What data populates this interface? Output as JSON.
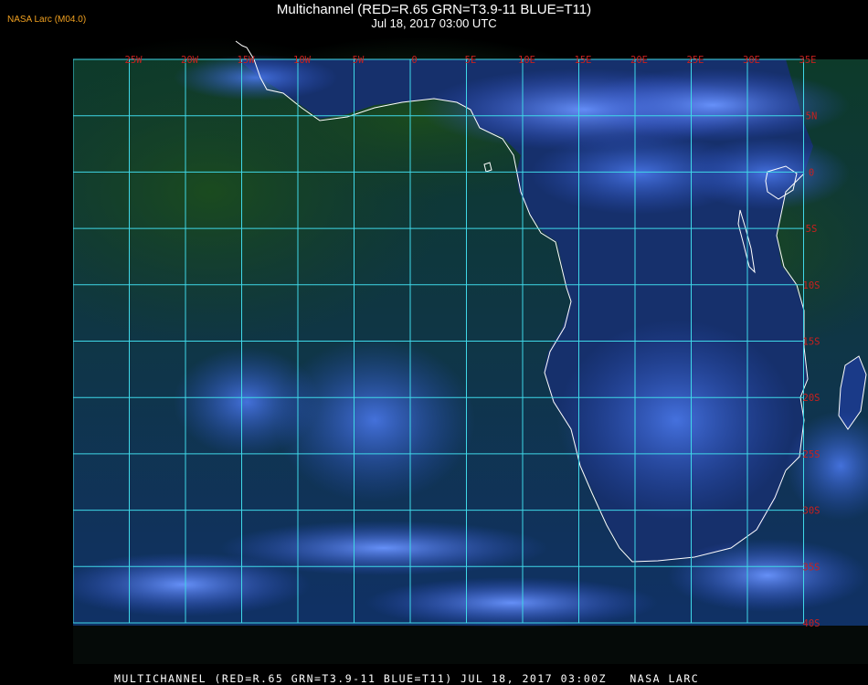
{
  "header": {
    "title": "Multichannel (RED=R.65 GRN=T3.9-11 BLUE=T11)",
    "datetime": "Jul 18, 2017 03:00 UTC",
    "badge": "NASA Larc (M04.0)"
  },
  "footer": {
    "caption": "MULTICHANNEL (RED=R.65 GRN=T3.9-11 BLUE=T11) JUL 18, 2017 03:00Z   NASA LARC"
  },
  "map": {
    "longitude_labels": [
      "25W",
      "20W",
      "15W",
      "10W",
      "5W",
      "0",
      "5E",
      "10E",
      "15E",
      "20E",
      "25E",
      "30E",
      "35E"
    ],
    "latitude_labels": [
      "5N",
      "0",
      "5S",
      "10S",
      "15S",
      "20S",
      "25S",
      "30S",
      "35S",
      "40S"
    ],
    "grid_color": "#3fd8e8",
    "label_color": "#c8201e",
    "coast_color": "#ffffff",
    "ocean_color": "#123a55",
    "land_color": "#15306e",
    "cloud_color": "#3c6ae0"
  }
}
